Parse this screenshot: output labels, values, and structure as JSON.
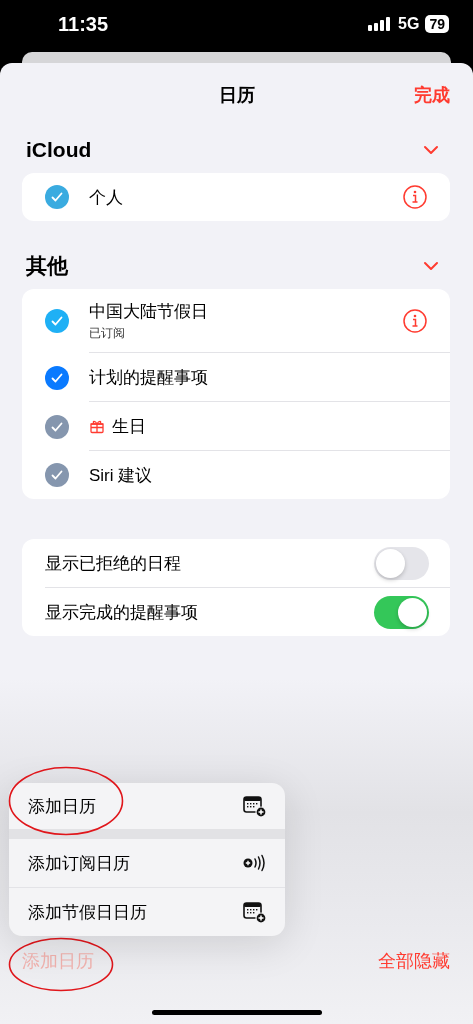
{
  "status_bar": {
    "time": "11:35",
    "network": "5G",
    "battery": "79"
  },
  "sheet": {
    "title": "日历",
    "done": "完成"
  },
  "sections": [
    {
      "title": "iCloud",
      "expanded": true,
      "calendars": [
        {
          "name": "个人",
          "checked": true,
          "color": "#3aabe0",
          "info": true,
          "kind": "calendar"
        }
      ]
    },
    {
      "title": "其他",
      "expanded": true,
      "calendars": [
        {
          "name": "中国大陆节假日",
          "subtitle": "已订阅",
          "checked": true,
          "color": "#1fb0f5",
          "info": true,
          "kind": "calendar"
        },
        {
          "name": "计划的提醒事项",
          "checked": true,
          "color": "#0a7aff",
          "info": false,
          "kind": "calendar"
        },
        {
          "name": "生日",
          "checked": true,
          "color": "#8596ae",
          "info": false,
          "kind": "birthday"
        },
        {
          "name": "Siri 建议",
          "checked": true,
          "color": "#8596ae",
          "info": false,
          "kind": "calendar"
        }
      ]
    }
  ],
  "toggles": [
    {
      "label": "显示已拒绝的日程",
      "on": false
    },
    {
      "label": "显示完成的提醒事项",
      "on": true
    }
  ],
  "menu": [
    {
      "label": "添加日历",
      "kind": "calendar",
      "circled": true
    },
    {
      "label": "添加订阅日历",
      "kind": "subscription",
      "circled": false
    },
    {
      "label": "添加节假日日历",
      "kind": "calendar",
      "circled": false
    }
  ],
  "toolbar": {
    "add": {
      "label": "添加日历",
      "disabled": true,
      "circled": true
    },
    "hide_all": "全部隐藏"
  }
}
